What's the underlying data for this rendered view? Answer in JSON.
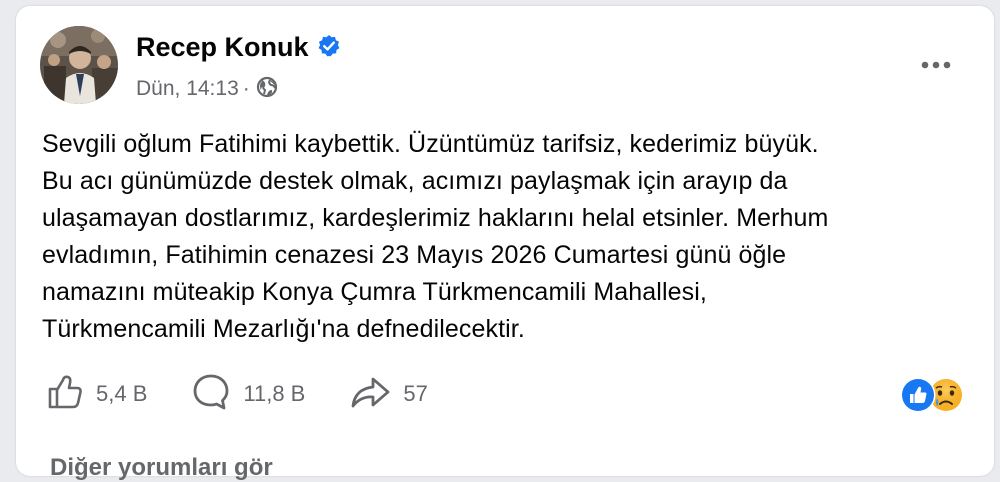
{
  "post": {
    "author": "Recep Konuk",
    "timestamp": "Dün, 14:13",
    "separator": "·",
    "privacy_icon": "globe-icon",
    "verified_icon": "verified-badge-icon",
    "text_lines": [
      "Sevgili oğlum Fatihimi kaybettik. Üzüntümüz tarifsiz, kederimiz büyük.",
      "Bu acı günümüzde destek olmak, acımızı paylaşmak için arayıp da",
      "ulaşamayan dostlarımız, kardeşlerimiz haklarını helal etsinler. Merhum",
      "evladımın, Fatihimin cenazesi 23 Mayıs 2026 Cumartesi günü öğle",
      "namazını müteakip Konya Çumra Türkmencamili Mahallesi,",
      "Türkmencamili Mezarlığı'na defnedilecektir."
    ]
  },
  "actions": {
    "like_count": "5,4 B",
    "comment_count": "11,8 B",
    "share_count": "57"
  },
  "reactions": [
    "like-reaction-icon",
    "sad-reaction-icon"
  ],
  "footer": {
    "more_comments_label": "Diğer yorumları gör"
  },
  "colors": {
    "accent": "#1877f2",
    "text_primary": "#050505",
    "text_secondary": "#65676b",
    "background": "#e9ebee",
    "card": "#ffffff"
  }
}
